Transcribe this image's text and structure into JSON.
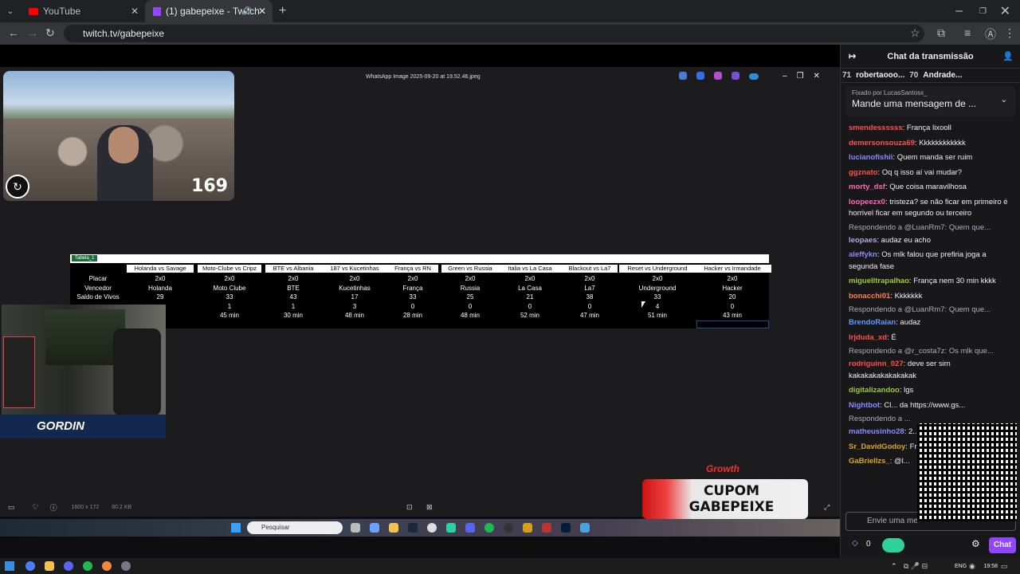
{
  "browser": {
    "tabs": [
      {
        "label": "YouTube"
      },
      {
        "label": "(1) gabepeixe - Twitch"
      }
    ],
    "url": "twitch.tv/gabepeixe"
  },
  "viewer": {
    "title": "WhatsApp Image 2025-09-20 at 19.52.46.jpeg",
    "status_dims": "1600 x 172",
    "status_size": "60.2 KB"
  },
  "overlay": {
    "counter": "169",
    "streamer_tag": "GORDIN",
    "coupon_brand": "Growth",
    "coupon_line1": "CUPOM",
    "coupon_line2": "GABEPEIXE"
  },
  "sheet": {
    "tab": "Tabela_1",
    "row_labels": [
      "Placar",
      "Vencedor",
      "Saldo de Vivos"
    ],
    "columns": [
      {
        "header": "Holanda vs Savage",
        "placar": "2x0",
        "vencedor": "Holanda",
        "saldo": "29",
        "r4": "",
        "tempo": ""
      },
      {
        "header": "Moto-Clube vs Cripz",
        "placar": "2x0",
        "vencedor": "Moto Clube",
        "saldo": "33",
        "r4": "1",
        "tempo": "45 min"
      },
      {
        "header": "BTE vs Albania",
        "placar": "2x0",
        "vencedor": "BTE",
        "saldo": "43",
        "r4": "1",
        "tempo": "30 min"
      },
      {
        "header": "187 vs Kucetinhas",
        "placar": "2x0",
        "vencedor": "Kucetinhas",
        "saldo": "17",
        "r4": "3",
        "tempo": "48 min"
      },
      {
        "header": "França vs RN",
        "placar": "2x0",
        "vencedor": "França",
        "saldo": "33",
        "r4": "0",
        "tempo": "28 min"
      },
      {
        "header": "Green vs Russia",
        "placar": "2x0",
        "vencedor": "Russia",
        "saldo": "25",
        "r4": "0",
        "tempo": "48 min"
      },
      {
        "header": "Italia vs La Casa",
        "placar": "2x0",
        "vencedor": "La Casa",
        "saldo": "21",
        "r4": "0",
        "tempo": "52 min"
      },
      {
        "header": "Blackout vs La7",
        "placar": "2x0",
        "vencedor": "La7",
        "saldo": "38",
        "r4": "0",
        "tempo": "47 min"
      },
      {
        "header": "Reset vs Underground",
        "placar": "2x0",
        "vencedor": "Underground",
        "saldo": "33",
        "r4": "4",
        "tempo": "51 min"
      },
      {
        "header": "Hacker vs Irmandade",
        "placar": "2x0",
        "vencedor": "Hacker",
        "saldo": "20",
        "r4": "0",
        "tempo": "43 min"
      }
    ]
  },
  "chat": {
    "title": "Chat da transmissão",
    "leaders": [
      {
        "rank": "71",
        "name": "robertaooo..."
      },
      {
        "rank": "70",
        "name": "Andrade..."
      }
    ],
    "pinned_by": "Fixado por LucasSantosx_",
    "pinned_text": "Mande uma mensagem de ...",
    "messages": [
      {
        "user": "smendessssss",
        "text": "França lixooll",
        "color": "#ff4f4f"
      },
      {
        "user": "demersonsouza69",
        "text": "Kkkkkkkkkkkk",
        "color": "#ff4f4f"
      },
      {
        "user": "lucianofishii",
        "text": "Quem manda ser ruim",
        "color": "#8a8aff"
      },
      {
        "user": "ggznato",
        "text": "Oq q isso aí vai mudar?",
        "color": "#ff4f4f"
      },
      {
        "user": "morty_dsf",
        "text": "Que coisa maravilhosa",
        "color": "#ff69b4"
      },
      {
        "user": "loopeezx0",
        "text": "tristeza? se não ficar em primeiro é horrivel ficar em segundo ou terceiro",
        "color": "#ff69b4"
      },
      {
        "reply": "Respondendo a @LuanRm7: Quem que..."
      },
      {
        "user": "leopaes",
        "text": "audaz eu acho",
        "color": "#b9a3e3"
      },
      {
        "user": "aleffykn",
        "text": "Os mlk falou que prefiria joga a segunda fase",
        "color": "#8a8aff"
      },
      {
        "user": "miguelltrapalhao",
        "text": "França nem 30 min kkkk",
        "color": "#9acd32"
      },
      {
        "user": "bonacchi01",
        "text": "Kkkkkkk",
        "color": "#ff7f50"
      },
      {
        "reply": "Respondendo a @LuanRm7: Quem que..."
      },
      {
        "user": "BrendoRaian",
        "text": "audaz",
        "color": "#5c9bff"
      },
      {
        "user": "lrjduda_xd",
        "text": "É",
        "color": "#ff4f4f"
      },
      {
        "reply": "Respondendo a @r_costa7z: Os mlk que..."
      },
      {
        "user": "rodriguinn_027",
        "text": "deve ser sim kakakakakakakakak",
        "color": "#ff4f4f"
      },
      {
        "user": "digitalizandoo",
        "text": "lgs",
        "color": "#9acd32"
      },
      {
        "user": "Nightbot",
        "text": "Cl... da https://www.gs...",
        "color": "#8a8aff"
      },
      {
        "reply": "Respondendo a ..."
      },
      {
        "user": "matheusinho28",
        "text": "2...",
        "color": "#8a8aff"
      },
      {
        "user": "Sr_DavidGodoy",
        "text": "Fr...",
        "color": "#daa520"
      },
      {
        "user": "GaBriellzs_",
        "text": "@l...",
        "color": "#daa520"
      }
    ],
    "input_placeholder": "Envie uma me",
    "points": "0",
    "chat_button": "Chat"
  },
  "taskbar": {
    "search": "Pesquisar",
    "lang": "ENG",
    "time": "19:58"
  }
}
